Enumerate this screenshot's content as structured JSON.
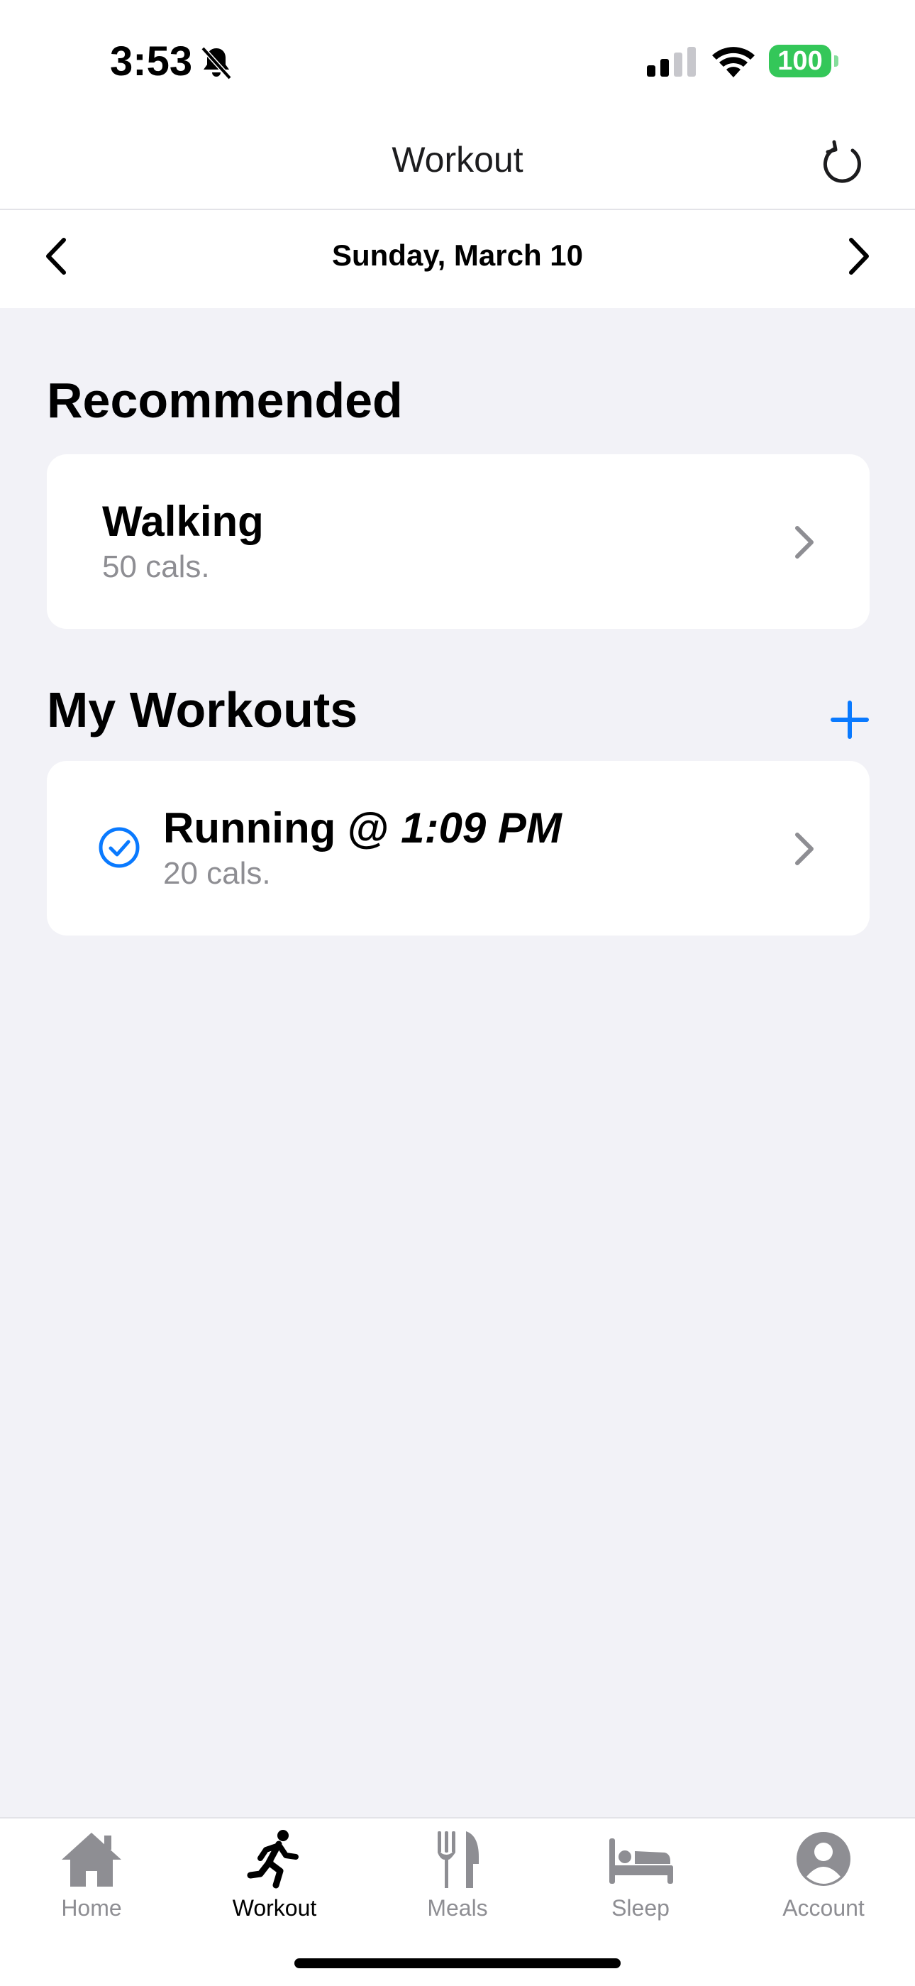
{
  "status_bar": {
    "time": "3:53",
    "battery": "100",
    "icons": [
      "bell-slash-icon",
      "cellular-signal-icon",
      "wifi-icon",
      "battery-icon"
    ]
  },
  "nav": {
    "title": "Workout",
    "refresh_icon": "refresh-icon"
  },
  "date_bar": {
    "date": "Sunday, March 10",
    "prev_icon": "chevron-left-icon",
    "next_icon": "chevron-right-icon"
  },
  "recommended": {
    "title": "Recommended",
    "items": [
      {
        "name": "Walking",
        "calories": "50 cals."
      }
    ]
  },
  "my_workouts": {
    "title": "My Workouts",
    "add_icon": "plus-icon",
    "items": [
      {
        "name": "Running @ ",
        "time": "1:09 PM",
        "calories": "20 cals.",
        "completed": true
      }
    ]
  },
  "tabs": [
    {
      "label": "Home",
      "icon": "house-icon",
      "active": false
    },
    {
      "label": "Workout",
      "icon": "figure-run-icon",
      "active": true
    },
    {
      "label": "Meals",
      "icon": "fork-knife-icon",
      "active": false
    },
    {
      "label": "Sleep",
      "icon": "bed-icon",
      "active": false
    },
    {
      "label": "Account",
      "icon": "person-circle-icon",
      "active": false
    }
  ],
  "colors": {
    "accent": "#0A7AFF",
    "background": "#F2F2F7",
    "secondary_text": "#8E8E93",
    "battery": "#34C759",
    "inactive_tab": "#8E8E93"
  }
}
